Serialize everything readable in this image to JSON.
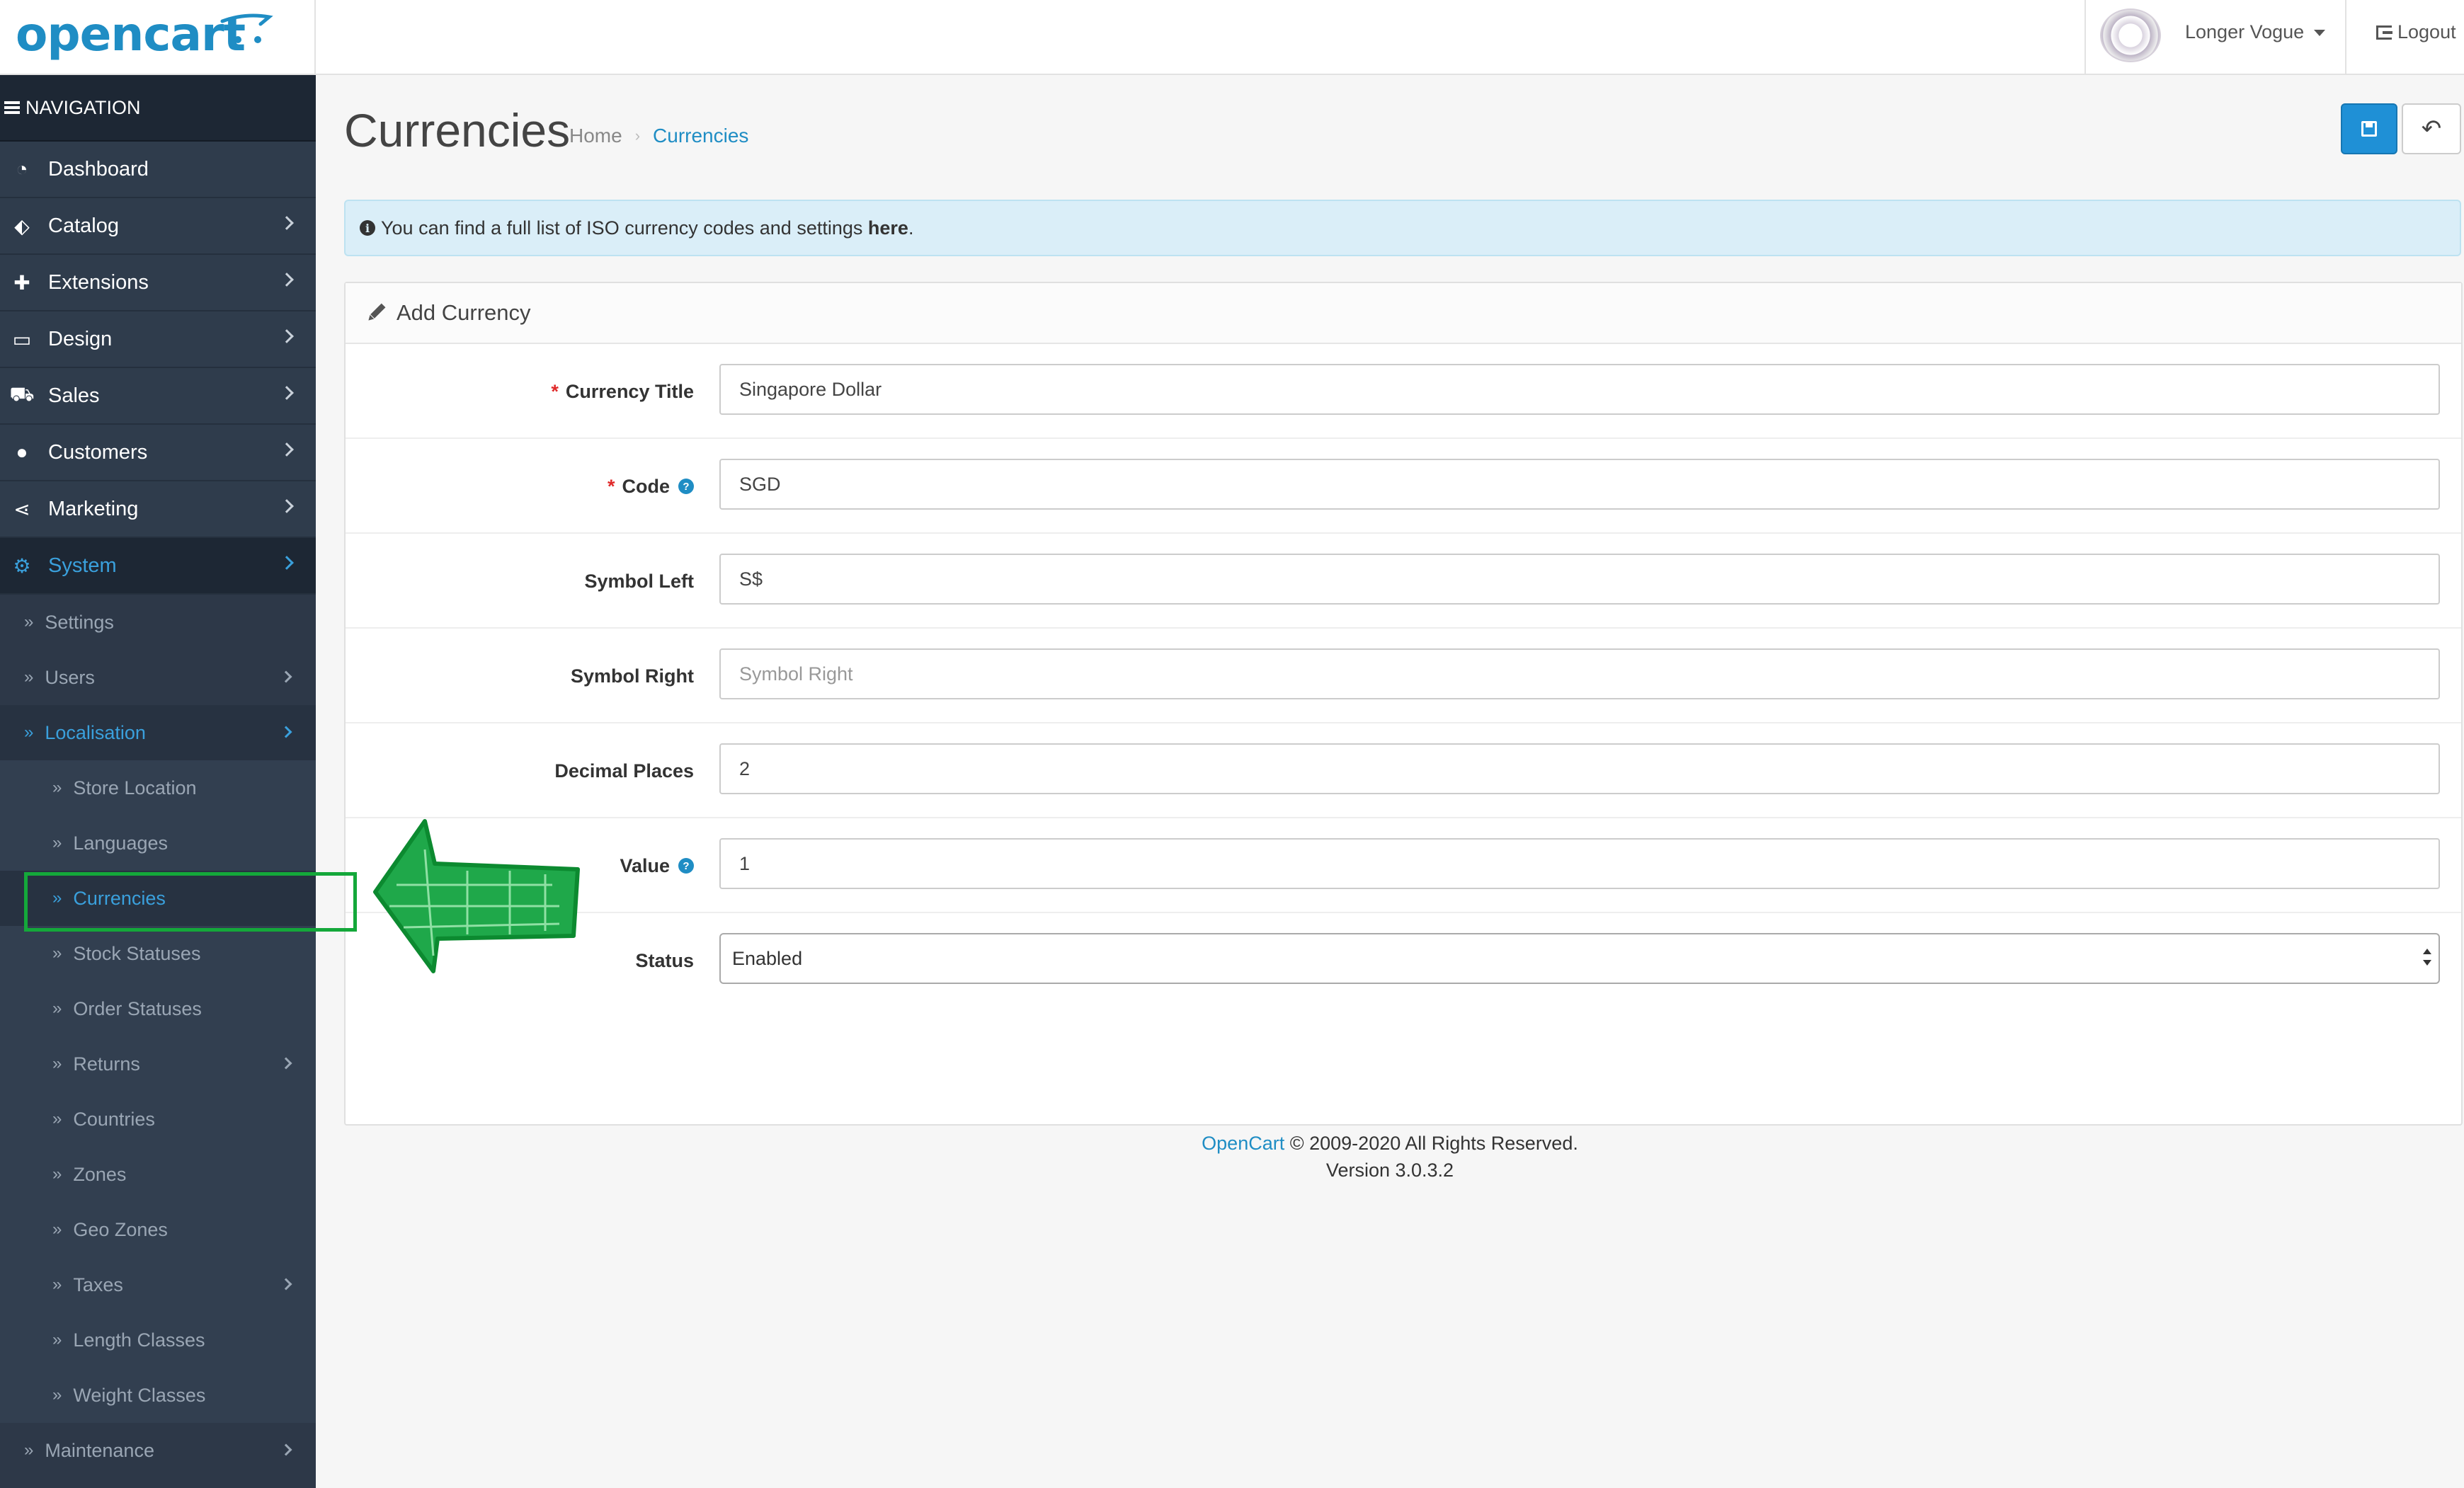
{
  "header": {
    "logo_text": "opencart",
    "user_name": "Longer Vogue",
    "logout_label": "Logout"
  },
  "sidebar": {
    "title": "NAVIGATION",
    "menu": [
      {
        "label": "Dashboard",
        "icon": "dashboard-icon"
      },
      {
        "label": "Catalog",
        "icon": "tags-icon"
      },
      {
        "label": "Extensions",
        "icon": "puzzle-icon"
      },
      {
        "label": "Design",
        "icon": "monitor-icon"
      },
      {
        "label": "Sales",
        "icon": "shopping-cart-icon"
      },
      {
        "label": "Customers",
        "icon": "user-icon"
      },
      {
        "label": "Marketing",
        "icon": "share-icon"
      },
      {
        "label": "System",
        "icon": "gear-icon"
      }
    ],
    "system_sub": [
      "Settings",
      "Users",
      "Localisation"
    ],
    "localisation_sub": [
      "Store Location",
      "Languages",
      "Currencies",
      "Stock Statuses",
      "Order Statuses",
      "Returns",
      "Countries",
      "Zones",
      "Geo Zones",
      "Taxes",
      "Length Classes",
      "Weight Classes"
    ],
    "maintenance": "Maintenance"
  },
  "page": {
    "title": "Currencies",
    "breadcrumb": {
      "home": "Home",
      "current": "Currencies"
    },
    "alert_prefix": "You can find a full list of ISO currency codes and settings ",
    "alert_link": "here",
    "alert_suffix": ".",
    "panel_title": "Add Currency"
  },
  "form": {
    "currency_title": {
      "label": "Currency Title",
      "value": "Singapore Dollar"
    },
    "code": {
      "label": "Code",
      "value": "SGD"
    },
    "symbol_left": {
      "label": "Symbol Left",
      "value": "S$"
    },
    "symbol_right": {
      "label": "Symbol Right",
      "value": "",
      "placeholder": "Symbol Right"
    },
    "decimal_places": {
      "label": "Decimal Places",
      "value": "2"
    },
    "value": {
      "label": "Value",
      "value": "1"
    },
    "status": {
      "label": "Status",
      "value": "Enabled"
    }
  },
  "footer": {
    "brand": "OpenCart",
    "copyright": " © 2009-2020 All Rights Reserved.",
    "version": "Version 3.0.3.2"
  },
  "colors": {
    "accent": "#1f8dc4",
    "sidebar_bg": "#2d3848",
    "annotation": "#14a83a"
  }
}
